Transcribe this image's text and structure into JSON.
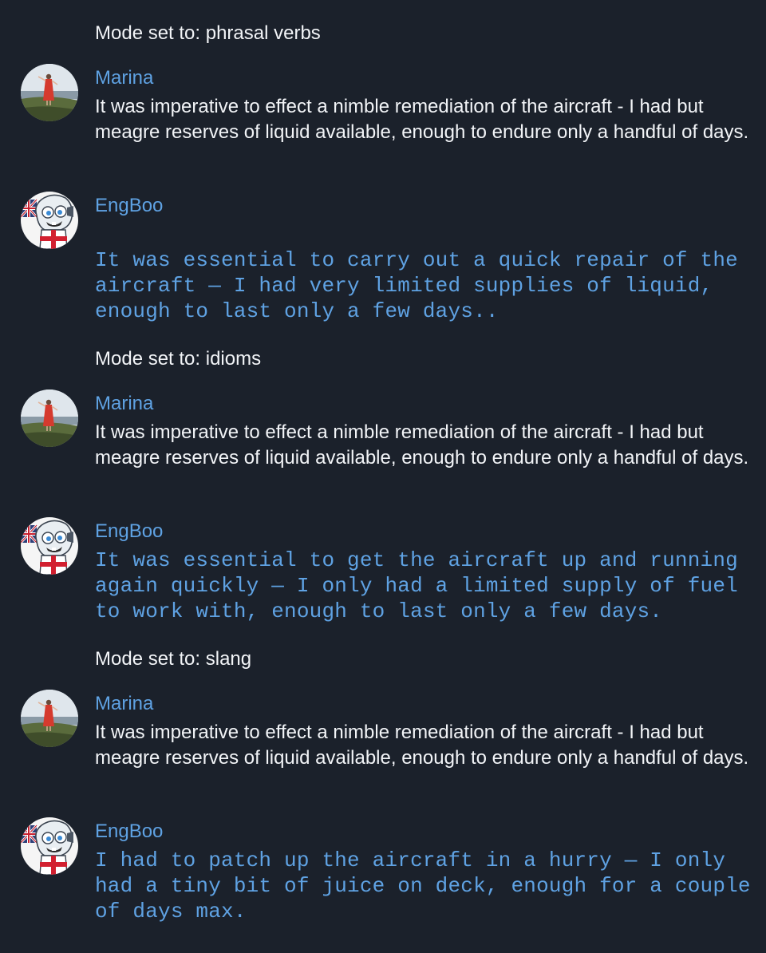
{
  "theme": {
    "background": "#1b212b",
    "text": "#f2f4f7",
    "accent": "#5fa2e3"
  },
  "messages": {
    "mode1": "Mode set to: phrasal verbs",
    "user1": {
      "sender": "Marina",
      "text": "It was imperative to effect a nimble remediation of the aircraft - I had but meagre reserves of liquid available, enough to endure only a handful of days."
    },
    "bot1": {
      "sender": "EngBoo",
      "text": "It was essential to carry out a quick repair of the\naircraft — I had very limited supplies of liquid,\nenough to last only a few days.."
    },
    "mode2": "Mode set to: idioms",
    "user2": {
      "sender": "Marina",
      "text": "It was imperative to effect a nimble remediation of the aircraft - I had but meagre reserves of liquid available, enough to endure only a handful of days."
    },
    "bot2": {
      "sender": "EngBoo",
      "text": "It was essential to get the aircraft up and running\nagain quickly — I only had a limited supply of fuel\nto work with, enough to last only a few days."
    },
    "mode3": "Mode set to: slang",
    "user3": {
      "sender": "Marina",
      "text": "It was imperative to effect a nimble remediation of the aircraft - I had but meagre reserves of liquid available, enough to endure only a handful of days."
    },
    "bot3": {
      "sender": "EngBoo",
      "text": "I had to patch up the aircraft in a hurry — I only\nhad a tiny bit of juice on deck, enough for a couple\nof days max."
    }
  },
  "icons": {
    "user_avatar": "woman-red-dress-avatar-icon",
    "bot_avatar": "robot-uk-flag-avatar-icon"
  }
}
